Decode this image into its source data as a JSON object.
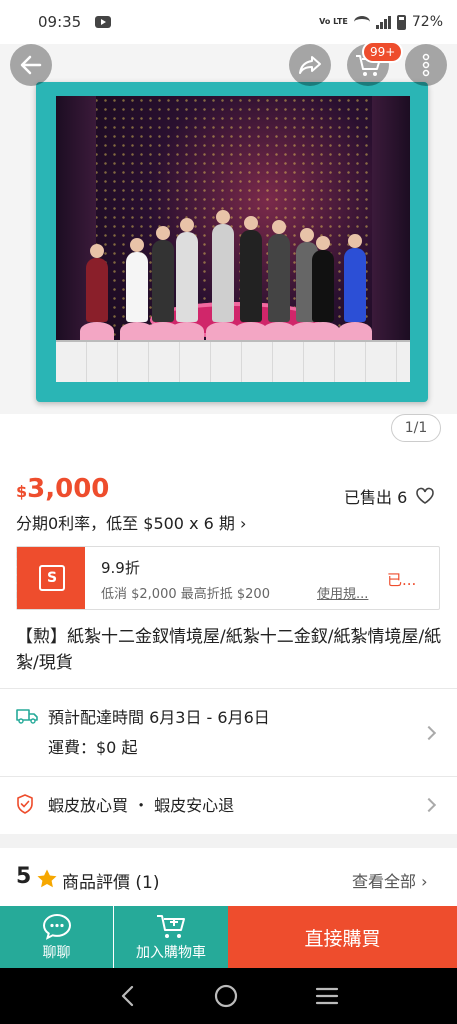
{
  "status_bar": {
    "time": "09:35",
    "network_label": "Vo LTE",
    "battery": "72%"
  },
  "header": {
    "cart_badge": "99+",
    "image_counter": "1/1"
  },
  "product": {
    "currency": "$",
    "price": "3,000",
    "sold": "已售出 6",
    "installment": "分期0利率，低至 $500 x 6 期 ›",
    "title": "【勲】紙紮十二金釵情境屋/紙紮十二金釵/紙紮情境屋/紙紮/現貨"
  },
  "voucher": {
    "title": "9.9折",
    "description": "低消 $2,000 最高折抵 $200",
    "terms_link": "使用規...",
    "claim_label": "已..."
  },
  "delivery": {
    "line1": "預計配達時間 6月3日 - 6月6日",
    "line2": "運費：$0 起"
  },
  "guarantee": {
    "text": "蝦皮放心買 ・ 蝦皮安心退"
  },
  "reviews": {
    "score": "5",
    "label": "商品評價 (1)",
    "see_all": "查看全部 ›"
  },
  "bottom_bar": {
    "chat_label": "聊聊",
    "cart_label": "加入購物車",
    "buy_label": "直接購買"
  },
  "colors": {
    "brand": "#ee4d2d",
    "teal": "#26aa99"
  }
}
